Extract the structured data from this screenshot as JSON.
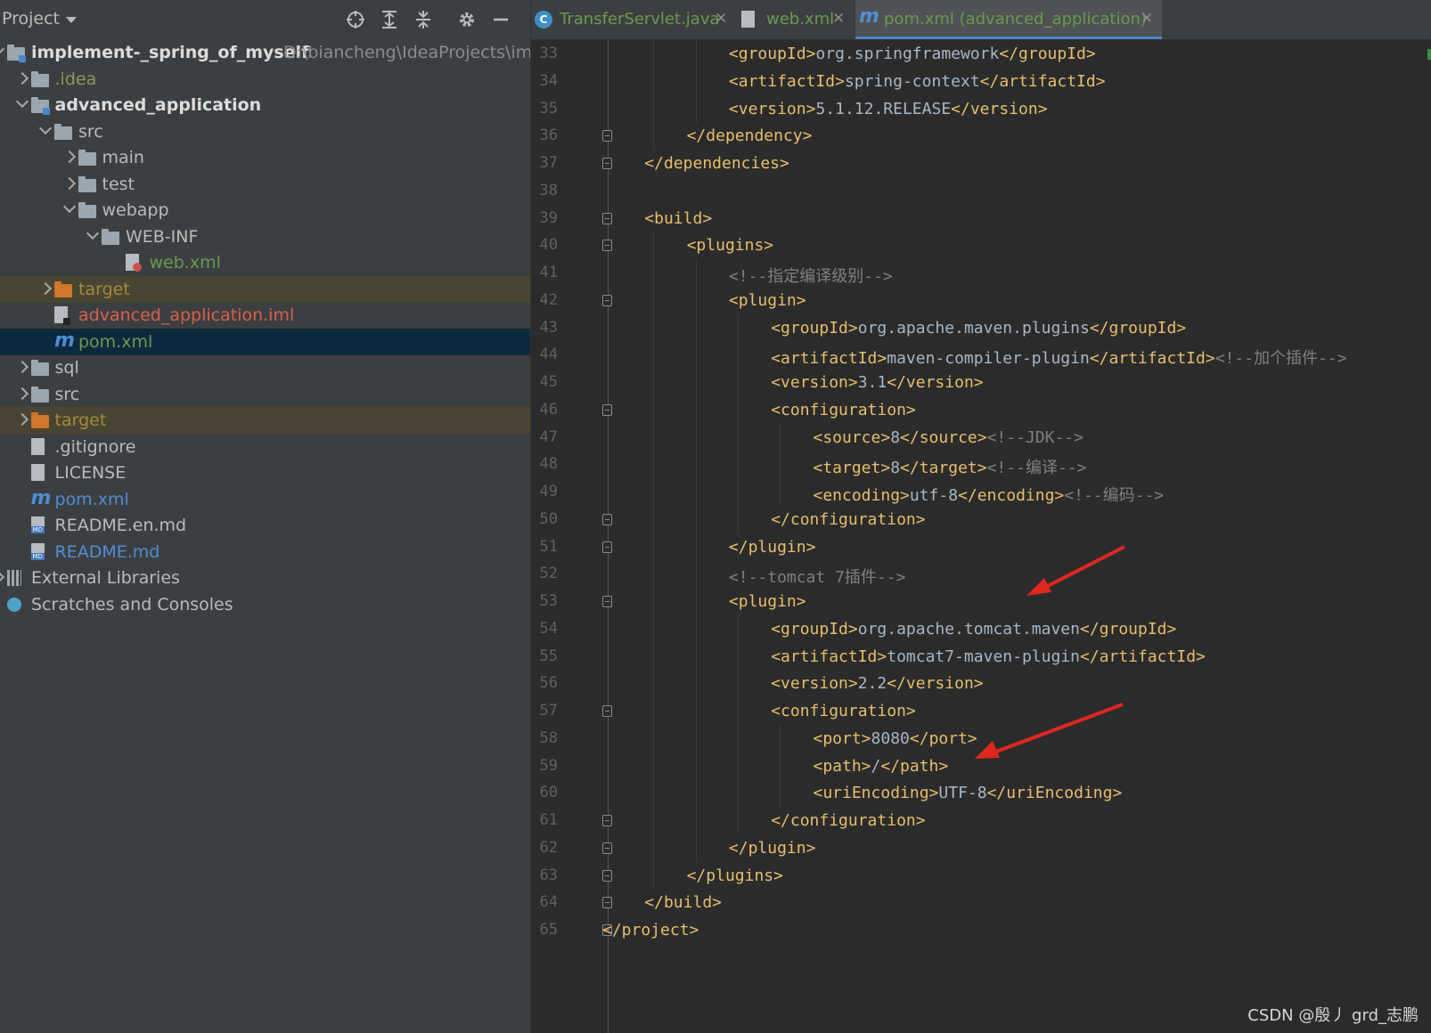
{
  "panel": {
    "title": "Project",
    "header_icons": [
      "locate-icon",
      "expand-all-icon",
      "collapse-all-icon",
      "gear-icon",
      "hide-icon"
    ]
  },
  "tree": [
    {
      "depth": 0,
      "arrow": "down",
      "icon": "module-folder",
      "label": "implement-_spring_of_myself",
      "path": "D:\\biancheng\\IdeaProjects\\implem",
      "color": "#dcdcdc",
      "bold": true,
      "state": ""
    },
    {
      "depth": 1,
      "arrow": "right",
      "icon": "folder",
      "label": ".idea",
      "color": "#8a9a5b",
      "state": ""
    },
    {
      "depth": 1,
      "arrow": "down",
      "icon": "module-folder",
      "label": "advanced_application",
      "color": "#dcdcdc",
      "bold": true,
      "state": ""
    },
    {
      "depth": 2,
      "arrow": "down",
      "icon": "folder",
      "label": "src",
      "color": "#bbbbbb",
      "state": ""
    },
    {
      "depth": 3,
      "arrow": "right",
      "icon": "folder",
      "label": "main",
      "color": "#bbbbbb",
      "state": ""
    },
    {
      "depth": 3,
      "arrow": "right",
      "icon": "folder",
      "label": "test",
      "color": "#bbbbbb",
      "state": ""
    },
    {
      "depth": 3,
      "arrow": "down",
      "icon": "folder",
      "label": "webapp",
      "color": "#bbbbbb",
      "state": ""
    },
    {
      "depth": 4,
      "arrow": "down",
      "icon": "folder",
      "label": "WEB-INF",
      "color": "#bbbbbb",
      "state": ""
    },
    {
      "depth": 5,
      "arrow": "none",
      "icon": "xml-file",
      "label": "web.xml",
      "color": "#6a9b4e",
      "state": ""
    },
    {
      "depth": 2,
      "arrow": "right",
      "icon": "folder-orange",
      "label": "target",
      "color": "#a48a3b",
      "state": "excl"
    },
    {
      "depth": 2,
      "arrow": "none",
      "icon": "iml-file",
      "label": "advanced_application.iml",
      "color": "#d9604a",
      "state": ""
    },
    {
      "depth": 2,
      "arrow": "none",
      "icon": "maven",
      "label": "pom.xml",
      "color": "#6a9b4e",
      "state": "sel"
    },
    {
      "depth": 1,
      "arrow": "right",
      "icon": "folder",
      "label": "sql",
      "color": "#bbbbbb",
      "state": ""
    },
    {
      "depth": 1,
      "arrow": "right",
      "icon": "folder",
      "label": "src",
      "color": "#bbbbbb",
      "state": ""
    },
    {
      "depth": 1,
      "arrow": "right",
      "icon": "folder-orange",
      "label": "target",
      "color": "#a48a3b",
      "state": "excl"
    },
    {
      "depth": 1,
      "arrow": "none",
      "icon": "ignore-file",
      "label": ".gitignore",
      "color": "#bbbbbb",
      "state": ""
    },
    {
      "depth": 1,
      "arrow": "none",
      "icon": "text-file",
      "label": "LICENSE",
      "color": "#bbbbbb",
      "state": ""
    },
    {
      "depth": 1,
      "arrow": "none",
      "icon": "maven",
      "label": "pom.xml",
      "color": "#4e8ed6",
      "state": ""
    },
    {
      "depth": 1,
      "arrow": "none",
      "icon": "md-file",
      "label": "README.en.md",
      "color": "#bbbbbb",
      "state": ""
    },
    {
      "depth": 1,
      "arrow": "none",
      "icon": "md-file",
      "label": "README.md",
      "color": "#4e8ed6",
      "state": ""
    },
    {
      "depth": 0,
      "arrow": "right",
      "icon": "libraries",
      "label": "External Libraries",
      "color": "#bbbbbb",
      "state": ""
    },
    {
      "depth": 0,
      "arrow": "none",
      "icon": "scratches",
      "label": "Scratches and Consoles",
      "color": "#bbbbbb",
      "state": ""
    }
  ],
  "tabs": [
    {
      "label": "TransferServlet.java",
      "icon": "java-class-icon",
      "color": "#6a9b4e",
      "active": false
    },
    {
      "label": "web.xml",
      "icon": "xml-file-icon",
      "color": "#6a9b4e",
      "active": false
    },
    {
      "label": "pom.xml (advanced_application)",
      "icon": "maven-icon",
      "color": "#6a9b4e",
      "active": true
    }
  ],
  "code": [
    {
      "n": "33",
      "indent": 3,
      "fold": false,
      "parts": [
        [
          "tag",
          "<groupId>"
        ],
        [
          "txt",
          "org.springframework"
        ],
        [
          "tag",
          "</groupId>"
        ]
      ]
    },
    {
      "n": "34",
      "indent": 3,
      "fold": false,
      "parts": [
        [
          "tag",
          "<artifactId>"
        ],
        [
          "txt",
          "spring-context"
        ],
        [
          "tag",
          "</artifactId>"
        ]
      ]
    },
    {
      "n": "35",
      "indent": 3,
      "fold": false,
      "parts": [
        [
          "tag",
          "<version>"
        ],
        [
          "txt",
          "5.1.12.RELEASE"
        ],
        [
          "tag",
          "</version>"
        ]
      ]
    },
    {
      "n": "36",
      "indent": 2,
      "fold": true,
      "parts": [
        [
          "tag",
          "</dependency>"
        ]
      ]
    },
    {
      "n": "37",
      "indent": 1,
      "fold": true,
      "parts": [
        [
          "tag",
          "</dependencies>"
        ]
      ]
    },
    {
      "n": "38",
      "indent": 0,
      "fold": false,
      "parts": []
    },
    {
      "n": "39",
      "indent": 1,
      "fold": true,
      "parts": [
        [
          "tag",
          "<build>"
        ]
      ]
    },
    {
      "n": "40",
      "indent": 2,
      "fold": true,
      "parts": [
        [
          "tag",
          "<plugins>"
        ]
      ]
    },
    {
      "n": "41",
      "indent": 3,
      "fold": false,
      "parts": [
        [
          "cmt",
          "<!--指定编译级别-->"
        ]
      ]
    },
    {
      "n": "42",
      "indent": 3,
      "fold": true,
      "parts": [
        [
          "tag",
          "<plugin>"
        ]
      ]
    },
    {
      "n": "43",
      "indent": 4,
      "fold": false,
      "parts": [
        [
          "tag",
          "<groupId>"
        ],
        [
          "txt",
          "org.apache.maven.plugins"
        ],
        [
          "tag",
          "</groupId>"
        ]
      ]
    },
    {
      "n": "44",
      "indent": 4,
      "fold": false,
      "parts": [
        [
          "tag",
          "<artifactId>"
        ],
        [
          "txt",
          "maven-compiler-plugin"
        ],
        [
          "tag",
          "</artifactId>"
        ],
        [
          "cmt",
          "<!--加个插件-->"
        ]
      ]
    },
    {
      "n": "45",
      "indent": 4,
      "fold": false,
      "parts": [
        [
          "tag",
          "<version>"
        ],
        [
          "txt",
          "3.1"
        ],
        [
          "tag",
          "</version>"
        ]
      ]
    },
    {
      "n": "46",
      "indent": 4,
      "fold": true,
      "parts": [
        [
          "tag",
          "<configuration>"
        ]
      ]
    },
    {
      "n": "47",
      "indent": 5,
      "fold": false,
      "parts": [
        [
          "tag",
          "<source>"
        ],
        [
          "txt",
          "8"
        ],
        [
          "tag",
          "</source>"
        ],
        [
          "cmt",
          "<!--JDK-->"
        ]
      ]
    },
    {
      "n": "48",
      "indent": 5,
      "fold": false,
      "parts": [
        [
          "tag",
          "<target>"
        ],
        [
          "txt",
          "8"
        ],
        [
          "tag",
          "</target>"
        ],
        [
          "cmt",
          "<!--编译-->"
        ]
      ]
    },
    {
      "n": "49",
      "indent": 5,
      "fold": false,
      "parts": [
        [
          "tag",
          "<encoding>"
        ],
        [
          "txt",
          "utf-8"
        ],
        [
          "tag",
          "</encoding>"
        ],
        [
          "cmt",
          "<!--编码-->"
        ]
      ]
    },
    {
      "n": "50",
      "indent": 4,
      "fold": true,
      "parts": [
        [
          "tag",
          "</configuration>"
        ]
      ]
    },
    {
      "n": "51",
      "indent": 3,
      "fold": true,
      "parts": [
        [
          "tag",
          "</plugin>"
        ]
      ]
    },
    {
      "n": "52",
      "indent": 3,
      "fold": false,
      "parts": [
        [
          "cmt",
          "<!--tomcat 7插件-->"
        ]
      ]
    },
    {
      "n": "53",
      "indent": 3,
      "fold": true,
      "parts": [
        [
          "tag",
          "<plugin>"
        ]
      ]
    },
    {
      "n": "54",
      "indent": 4,
      "fold": false,
      "parts": [
        [
          "tag",
          "<groupId>"
        ],
        [
          "txt",
          "org.apache.tomcat.maven"
        ],
        [
          "tag",
          "</groupId>"
        ]
      ]
    },
    {
      "n": "55",
      "indent": 4,
      "fold": false,
      "parts": [
        [
          "tag",
          "<artifactId>"
        ],
        [
          "txt",
          "tomcat7-maven-plugin"
        ],
        [
          "tag",
          "</artifactId>"
        ]
      ]
    },
    {
      "n": "56",
      "indent": 4,
      "fold": false,
      "parts": [
        [
          "tag",
          "<version>"
        ],
        [
          "txt",
          "2.2"
        ],
        [
          "tag",
          "</version>"
        ]
      ]
    },
    {
      "n": "57",
      "indent": 4,
      "fold": true,
      "parts": [
        [
          "tag",
          "<configuration>"
        ]
      ]
    },
    {
      "n": "58",
      "indent": 5,
      "fold": false,
      "parts": [
        [
          "tag",
          "<port>"
        ],
        [
          "txt",
          "8080"
        ],
        [
          "tag",
          "</port>"
        ]
      ]
    },
    {
      "n": "59",
      "indent": 5,
      "fold": false,
      "parts": [
        [
          "tag",
          "<path>"
        ],
        [
          "txt",
          "/"
        ],
        [
          "tag",
          "</path>"
        ]
      ]
    },
    {
      "n": "60",
      "indent": 5,
      "fold": false,
      "parts": [
        [
          "tag",
          "<uriEncoding>"
        ],
        [
          "txt",
          "UTF-8"
        ],
        [
          "tag",
          "</uriEncoding>"
        ]
      ]
    },
    {
      "n": "61",
      "indent": 4,
      "fold": true,
      "parts": [
        [
          "tag",
          "</configuration>"
        ]
      ]
    },
    {
      "n": "62",
      "indent": 3,
      "fold": true,
      "parts": [
        [
          "tag",
          "</plugin>"
        ]
      ]
    },
    {
      "n": "63",
      "indent": 2,
      "fold": true,
      "parts": [
        [
          "tag",
          "</plugins>"
        ]
      ]
    },
    {
      "n": "64",
      "indent": 1,
      "fold": true,
      "parts": [
        [
          "tag",
          "</build>"
        ]
      ]
    },
    {
      "n": "65",
      "indent": 0,
      "fold": true,
      "parts": [
        [
          "tag",
          "</project>"
        ]
      ]
    }
  ],
  "colors": {
    "tag": "#e8bf6a",
    "text": "#a9b7c6",
    "comment": "#808080",
    "annotation_arrow": "#e0271f"
  },
  "watermark": "CSDN @殷丿 grd_志鹏"
}
